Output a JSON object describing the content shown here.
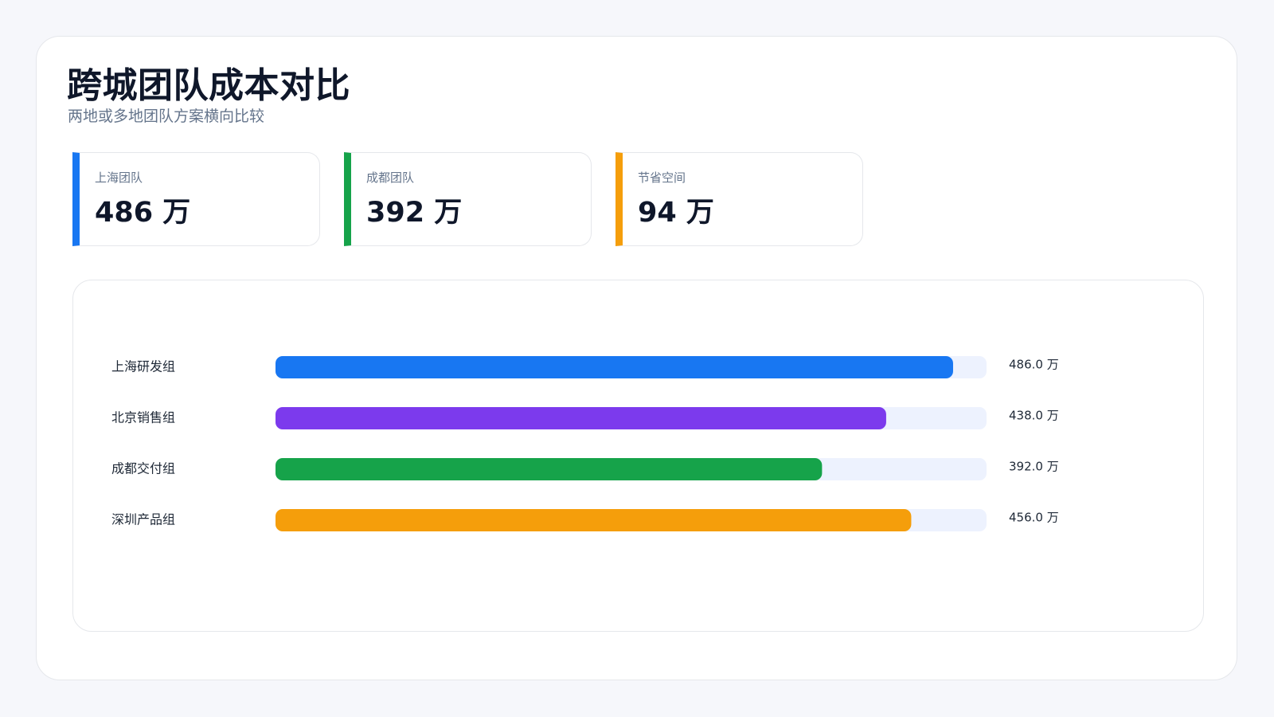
{
  "header": {
    "title": "跨城团队成本对比",
    "subtitle": "两地或多地团队方案横向比较"
  },
  "kpis": [
    {
      "label": "上海团队",
      "value": "486 万",
      "color": "#1877f2"
    },
    {
      "label": "成都团队",
      "value": "392 万",
      "color": "#16a34a"
    },
    {
      "label": "节省空间",
      "value": "94 万",
      "color": "#f59e0b"
    }
  ],
  "chart_data": {
    "type": "bar",
    "orientation": "horizontal",
    "categories": [
      "上海研发组",
      "北京销售组",
      "成都交付组",
      "深圳产品组"
    ],
    "values": [
      486.0,
      438.0,
      392.0,
      456.0
    ],
    "value_labels": [
      "486.0 万",
      "438.0 万",
      "392.0 万",
      "456.0 万"
    ],
    "colors": [
      "#1877f2",
      "#7c3aed",
      "#16a34a",
      "#f59e0b"
    ],
    "track_color": "#edf2fe",
    "xlim": [
      0,
      510
    ],
    "unit": "万",
    "grid": false
  }
}
